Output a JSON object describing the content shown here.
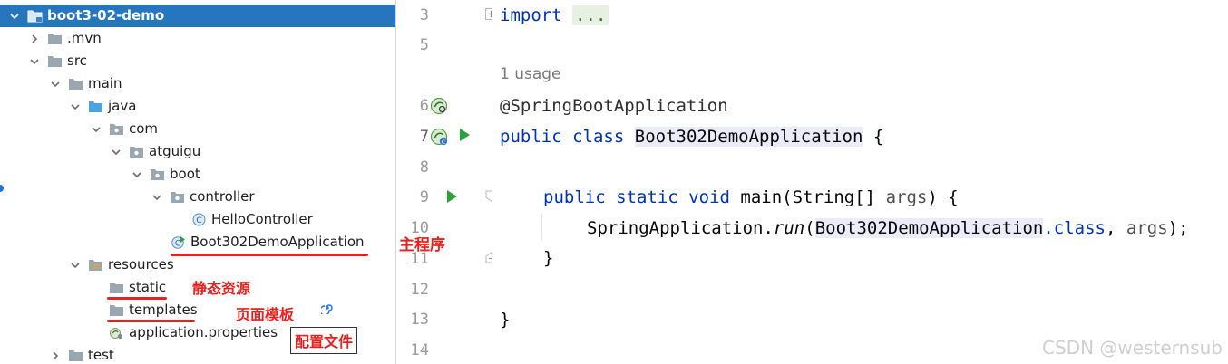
{
  "tree": {
    "items": [
      {
        "label": "boot3-02-demo",
        "icon": "module-folder-icon",
        "expanded": true
      },
      {
        "label": ".mvn",
        "icon": "folder-icon",
        "expanded": false
      },
      {
        "label": "src",
        "icon": "folder-icon",
        "expanded": true
      },
      {
        "label": "main",
        "icon": "folder-icon",
        "expanded": true
      },
      {
        "label": "java",
        "icon": "source-folder-icon",
        "expanded": true
      },
      {
        "label": "com",
        "icon": "package-icon",
        "expanded": true
      },
      {
        "label": "atguigu",
        "icon": "package-icon",
        "expanded": true
      },
      {
        "label": "boot",
        "icon": "package-icon",
        "expanded": true
      },
      {
        "label": "controller",
        "icon": "package-icon",
        "expanded": true
      },
      {
        "label": "HelloController",
        "icon": "class-icon"
      },
      {
        "label": "Boot302DemoApplication",
        "icon": "spring-boot-class-icon"
      },
      {
        "label": "resources",
        "icon": "resources-folder-icon",
        "expanded": true
      },
      {
        "label": "static",
        "icon": "folder-icon"
      },
      {
        "label": "templates",
        "icon": "folder-icon"
      },
      {
        "label": "application.properties",
        "icon": "spring-properties-icon"
      },
      {
        "label": "test",
        "icon": "folder-icon",
        "expanded": false
      }
    ],
    "annotations": {
      "main_program": "主程序",
      "static_resources": "静态资源",
      "page_templates": "页面模板",
      "config_file": "配置文件"
    }
  },
  "gutter": {
    "line_numbers": [
      "3",
      "5",
      "6",
      "7",
      "8",
      "9",
      "10",
      "11",
      "12",
      "13",
      "14"
    ]
  },
  "editor": {
    "usage_hint": "1 usage",
    "lines": {
      "import_kw": "import",
      "import_dots": "...",
      "annotation": "@SpringBootApplication",
      "public1": "public",
      "class_kw": "class",
      "class_name": "Boot302DemoApplication",
      "brace_open": "{",
      "public2": "public",
      "static_kw": "static",
      "void_kw": "void",
      "main_sig": "main(String[]",
      "args_param": "args",
      "main_end": ") {",
      "spring_app": "SpringApplication.",
      "run_method": "run",
      "paren_open": "(",
      "class_ref": "Boot302DemoApplication",
      "class_kw2": ".class",
      "comma": ", ",
      "args_ref": "args",
      "stmt_end": ");",
      "inner_close": "}",
      "outer_close": "}"
    }
  },
  "watermark": "CSDN @westernsub",
  "colors": {
    "selection": "#2675bf",
    "keyword": "#0033b3",
    "annotation_red": "#e8211e",
    "run_green": "#2aa13a"
  }
}
